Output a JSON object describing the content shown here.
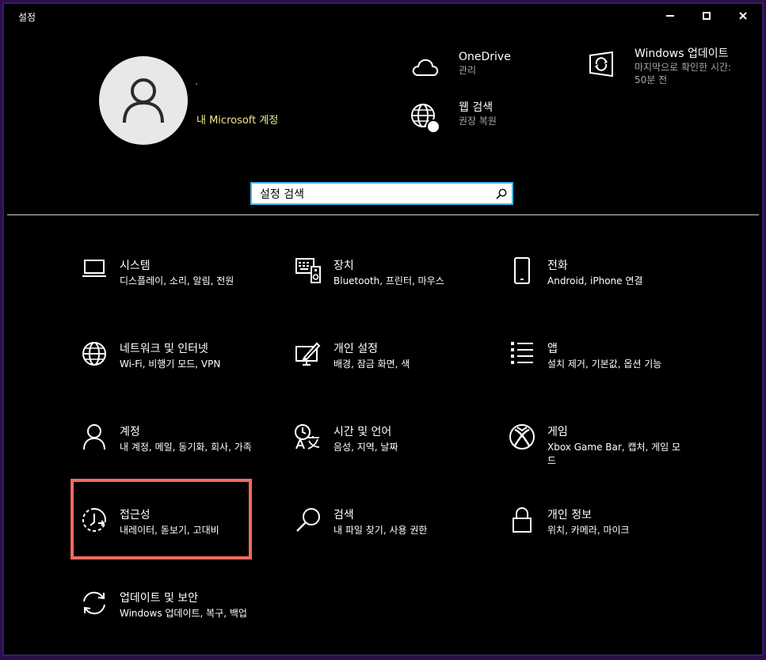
{
  "window": {
    "title": "설정",
    "controls": {
      "minimize": "minimize-icon",
      "maximize": "maximize-icon",
      "close": "close-icon"
    }
  },
  "account": {
    "link": "내 Microsoft 계정"
  },
  "quick": [
    {
      "title": "OneDrive",
      "subtitle": "관리",
      "icon": "cloud-icon"
    },
    {
      "title": "웹 검색",
      "subtitle": "권장 복원",
      "icon": "globe-icon"
    },
    {
      "title": "Windows 업데이트",
      "subtitle": "마지막으로 확인한 시간: 50분 전",
      "icon": "windows-update-icon"
    }
  ],
  "search": {
    "placeholder": "설정 검색",
    "icon": "search-icon"
  },
  "tiles": [
    {
      "title": "시스템",
      "subtitle": "디스플레이, 소리, 알림, 전원",
      "icon": "laptop-icon"
    },
    {
      "title": "장치",
      "subtitle": "Bluetooth, 프린터, 마우스",
      "icon": "devices-icon"
    },
    {
      "title": "전화",
      "subtitle": "Android, iPhone 연결",
      "icon": "phone-icon"
    },
    {
      "title": "네트워크 및 인터넷",
      "subtitle": "Wi-Fi, 비행기 모드, VPN",
      "icon": "globe-icon"
    },
    {
      "title": "개인 설정",
      "subtitle": "배경, 잠금 화면, 색",
      "icon": "personalization-icon"
    },
    {
      "title": "앱",
      "subtitle": "설치 제거, 기본값, 옵션 기능",
      "icon": "apps-list-icon"
    },
    {
      "title": "계정",
      "subtitle": "내 계정, 메일, 동기화, 회사, 가족",
      "icon": "person-icon"
    },
    {
      "title": "시간 및 언어",
      "subtitle": "음성, 지역, 날짜",
      "icon": "time-language-icon"
    },
    {
      "title": "게임",
      "subtitle": "Xbox Game Bar, 캡처, 게임 모드",
      "icon": "xbox-icon"
    },
    {
      "title": "접근성",
      "subtitle": "내레이터, 돋보기, 고대비",
      "icon": "accessibility-icon"
    },
    {
      "title": "검색",
      "subtitle": "내 파일 찾기, 사용 권한",
      "icon": "search-icon"
    },
    {
      "title": "개인 정보",
      "subtitle": "위치, 카메라, 마이크",
      "icon": "lock-icon"
    },
    {
      "title": "업데이트 및 보안",
      "subtitle": "Windows 업데이트, 복구, 백업",
      "icon": "sync-icon"
    }
  ],
  "colors": {
    "background": "#000000",
    "search_border": "#42b4e6",
    "highlight": "#f26b5b",
    "account_link": "#f0e68c"
  }
}
